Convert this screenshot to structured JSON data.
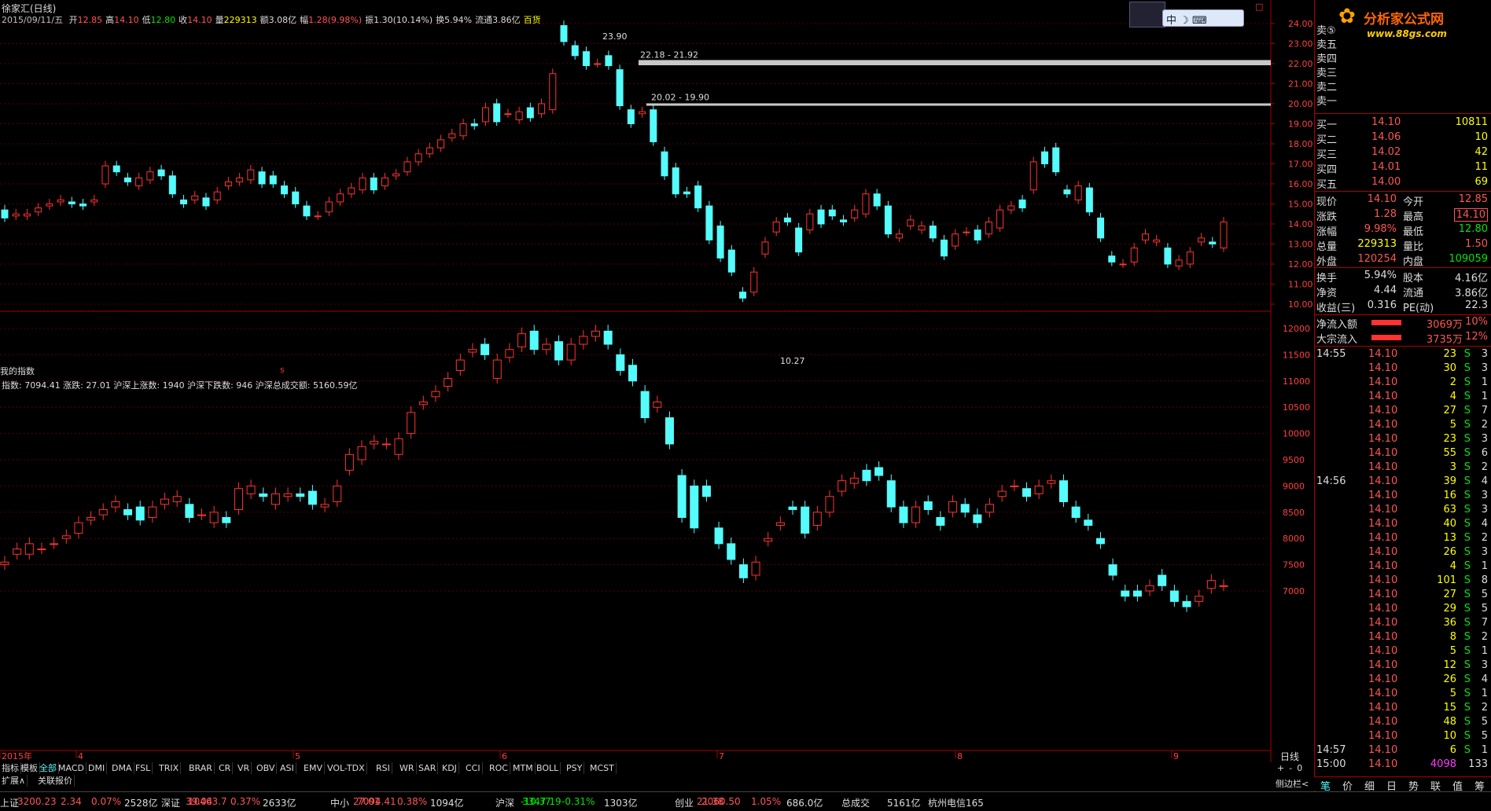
{
  "header": {
    "title": "徐家汇(日线)",
    "date": "2015/09/11/五",
    "items": [
      {
        "label": "开",
        "value": "12.85",
        "vc": "#ff5555"
      },
      {
        "label": "高",
        "value": "14.10",
        "vc": "#ff5555"
      },
      {
        "label": "低",
        "value": "12.80",
        "vc": "#00e600"
      },
      {
        "label": "收",
        "value": "14.10",
        "vc": "#ff5555"
      },
      {
        "label": "量",
        "value": "229313",
        "vc": "#ffff00"
      },
      {
        "label": "额",
        "value": "3.08亿",
        "vc": "#ddd"
      },
      {
        "label": "幅",
        "value": "1.28(9.98%)",
        "vc": "#ff5555"
      },
      {
        "label": "振",
        "value": "1.30(10.14%)",
        "vc": "#ddd"
      },
      {
        "label": "换",
        "value": "5.94%",
        "vc": "#ddd"
      },
      {
        "label": "流通",
        "value": "3.86亿",
        "vc": "#ddd"
      },
      {
        "label": "",
        "value": "百货",
        "vc": "#ffff00"
      }
    ]
  },
  "logo": {
    "brand": "分析家公式网",
    "url": "www.88gs.com"
  },
  "ime": {
    "label": "中"
  },
  "price_annotations": {
    "high": "23.90",
    "low": "10.27",
    "zone1": "22.18 - 21.92",
    "zone2": "20.02 - 19.90"
  },
  "sub_panel": {
    "title": "我的指数",
    "info": "指数: 7094.41 涨跌: 27.01 沪深上涨数: 1940 沪深下跌数: 946 沪深总成交额: 5160.59亿"
  },
  "marker_red": "s",
  "upper_yaxis": [
    "24.00",
    "23.00",
    "22.00",
    "21.00",
    "20.00",
    "19.00",
    "18.00",
    "17.00",
    "16.00",
    "15.00",
    "14.00",
    "13.00",
    "12.00",
    "11.00",
    "10.00"
  ],
  "lower_yaxis": [
    "12000",
    "11500",
    "11000",
    "10500",
    "10000",
    "9500",
    "9000",
    "8500",
    "8000",
    "7500",
    "7000"
  ],
  "xaxis": [
    "2015年",
    "4",
    "5",
    "6",
    "7",
    "8",
    "9"
  ],
  "period_label": "日线",
  "indicator_tabs": [
    "指标",
    "模板",
    "全部",
    "MACD",
    "DMI",
    "DMA",
    "FSL",
    "TRIX",
    "BRAR",
    "CR",
    "VR",
    "OBV",
    "ASI",
    "EMV",
    "VOL-TDX",
    "RSI",
    "WR",
    "SAR",
    "KDJ",
    "CCI",
    "ROC",
    "MTM",
    "BOLL",
    "PSY",
    "MCST"
  ],
  "bottom_tabs": [
    "扩展∧",
    "关联报价"
  ],
  "zoom_controls": [
    "+",
    "-",
    "0"
  ],
  "side_label": "侧边栏<",
  "quote": {
    "asks": [
      {
        "label": "卖五",
        "price": "",
        "vol": ""
      },
      {
        "label": "卖四",
        "price": "",
        "vol": ""
      },
      {
        "label": "卖三",
        "price": "",
        "vol": ""
      },
      {
        "label": "卖二",
        "price": "",
        "vol": ""
      },
      {
        "label": "卖一",
        "price": "",
        "vol": ""
      }
    ],
    "ask_header": "卖⑤",
    "bids": [
      {
        "label": "买一",
        "price": "14.10",
        "vol": "10811"
      },
      {
        "label": "买二",
        "price": "14.06",
        "vol": "10"
      },
      {
        "label": "买三",
        "price": "14.02",
        "vol": "42"
      },
      {
        "label": "买四",
        "price": "14.01",
        "vol": "11"
      },
      {
        "label": "买五",
        "price": "14.00",
        "vol": "69"
      }
    ],
    "stats": [
      {
        "l1": "现价",
        "v1": "14.10",
        "c1": "#ff5555",
        "l2": "今开",
        "v2": "12.85",
        "c2": "#ff5555"
      },
      {
        "l1": "涨跌",
        "v1": "1.28",
        "c1": "#ff5555",
        "l2": "最高",
        "v2": "14.10",
        "c2": "#ff5555"
      },
      {
        "l1": "涨幅",
        "v1": "9.98%",
        "c1": "#ff5555",
        "l2": "最低",
        "v2": "12.80",
        "c2": "#00e600"
      },
      {
        "l1": "总量",
        "v1": "229313",
        "c1": "#ffff00",
        "l2": "量比",
        "v2": "1.50",
        "c2": "#ff5555"
      },
      {
        "l1": "外盘",
        "v1": "120254",
        "c1": "#ff5555",
        "l2": "内盘",
        "v2": "109059",
        "c2": "#00e600"
      }
    ],
    "stats2": [
      {
        "l1": "换手",
        "v1": "5.94%",
        "l2": "股本",
        "v2": "4.16亿"
      },
      {
        "l1": "净资",
        "v1": "4.44",
        "l2": "流通",
        "v2": "3.86亿"
      },
      {
        "l1": "收益(三)",
        "v1": "0.316",
        "l2": "PE(动)",
        "v2": "22.3"
      }
    ],
    "flows": [
      {
        "label": "净流入额",
        "value": "3069万",
        "pct": "10%"
      },
      {
        "label": "大宗流入",
        "value": "3735万",
        "pct": "12%"
      }
    ]
  },
  "ticks": [
    {
      "t": "14:55",
      "p": "14.10",
      "v": "23",
      "s": "S",
      "n": "3"
    },
    {
      "t": "",
      "p": "14.10",
      "v": "30",
      "s": "S",
      "n": "3"
    },
    {
      "t": "",
      "p": "14.10",
      "v": "2",
      "s": "S",
      "n": "1"
    },
    {
      "t": "",
      "p": "14.10",
      "v": "4",
      "s": "S",
      "n": "1"
    },
    {
      "t": "",
      "p": "14.10",
      "v": "27",
      "s": "S",
      "n": "7"
    },
    {
      "t": "",
      "p": "14.10",
      "v": "5",
      "s": "S",
      "n": "2"
    },
    {
      "t": "",
      "p": "14.10",
      "v": "23",
      "s": "S",
      "n": "3"
    },
    {
      "t": "",
      "p": "14.10",
      "v": "55",
      "s": "S",
      "n": "6"
    },
    {
      "t": "",
      "p": "14.10",
      "v": "3",
      "s": "S",
      "n": "2"
    },
    {
      "t": "14:56",
      "p": "14.10",
      "v": "39",
      "s": "S",
      "n": "4"
    },
    {
      "t": "",
      "p": "14.10",
      "v": "16",
      "s": "S",
      "n": "3"
    },
    {
      "t": "",
      "p": "14.10",
      "v": "63",
      "s": "S",
      "n": "3"
    },
    {
      "t": "",
      "p": "14.10",
      "v": "40",
      "s": "S",
      "n": "4"
    },
    {
      "t": "",
      "p": "14.10",
      "v": "13",
      "s": "S",
      "n": "2"
    },
    {
      "t": "",
      "p": "14.10",
      "v": "26",
      "s": "S",
      "n": "3"
    },
    {
      "t": "",
      "p": "14.10",
      "v": "4",
      "s": "S",
      "n": "1"
    },
    {
      "t": "",
      "p": "14.10",
      "v": "101",
      "s": "S",
      "n": "8"
    },
    {
      "t": "",
      "p": "14.10",
      "v": "27",
      "s": "S",
      "n": "5"
    },
    {
      "t": "",
      "p": "14.10",
      "v": "29",
      "s": "S",
      "n": "5"
    },
    {
      "t": "",
      "p": "14.10",
      "v": "36",
      "s": "S",
      "n": "7"
    },
    {
      "t": "",
      "p": "14.10",
      "v": "8",
      "s": "S",
      "n": "2"
    },
    {
      "t": "",
      "p": "14.10",
      "v": "5",
      "s": "S",
      "n": "1"
    },
    {
      "t": "",
      "p": "14.10",
      "v": "12",
      "s": "S",
      "n": "3"
    },
    {
      "t": "",
      "p": "14.10",
      "v": "26",
      "s": "S",
      "n": "4"
    },
    {
      "t": "",
      "p": "14.10",
      "v": "5",
      "s": "S",
      "n": "1"
    },
    {
      "t": "",
      "p": "14.10",
      "v": "15",
      "s": "S",
      "n": "2"
    },
    {
      "t": "",
      "p": "14.10",
      "v": "48",
      "s": "S",
      "n": "5"
    },
    {
      "t": "",
      "p": "14.10",
      "v": "10",
      "s": "S",
      "n": "5"
    },
    {
      "t": "14:57",
      "p": "14.10",
      "v": "6",
      "s": "S",
      "n": "1"
    },
    {
      "t": "15:00",
      "p": "14.10",
      "v": "4098",
      "s": "",
      "n": "133"
    }
  ],
  "right_tabs": [
    "笔",
    "价",
    "细",
    "日",
    "势",
    "联",
    "值",
    "筹"
  ],
  "status_bar": [
    {
      "name": "上证",
      "value": "3200.23",
      "chg": "2.34",
      "pct": "0.07%",
      "amt": "2528亿"
    },
    {
      "name": "深证",
      "value": "10463.7",
      "chg": "39.04",
      "pct": "0.37%",
      "amt": "2633亿"
    },
    {
      "name": "中小",
      "value": "7094.41",
      "chg": "27.01",
      "pct": "0.38%",
      "amt": "1094亿"
    },
    {
      "name": "沪深",
      "value": "3347.19",
      "chg": "-10.37",
      "pct": "-0.31%",
      "amt": "1303亿"
    },
    {
      "name": "创业",
      "value": "2060.50",
      "chg": "21.38",
      "pct": "1.05%",
      "amt": "686.0亿"
    }
  ],
  "total": {
    "label": "总成交",
    "value": "5161亿"
  },
  "location": "杭州电信165",
  "chart_data": {
    "type": "candlestick",
    "upper_ylim": [
      10,
      24
    ],
    "lower_ylim": [
      6800,
      12100
    ],
    "colors": {
      "up": "#ff3232",
      "down": "#54fcfc"
    }
  }
}
